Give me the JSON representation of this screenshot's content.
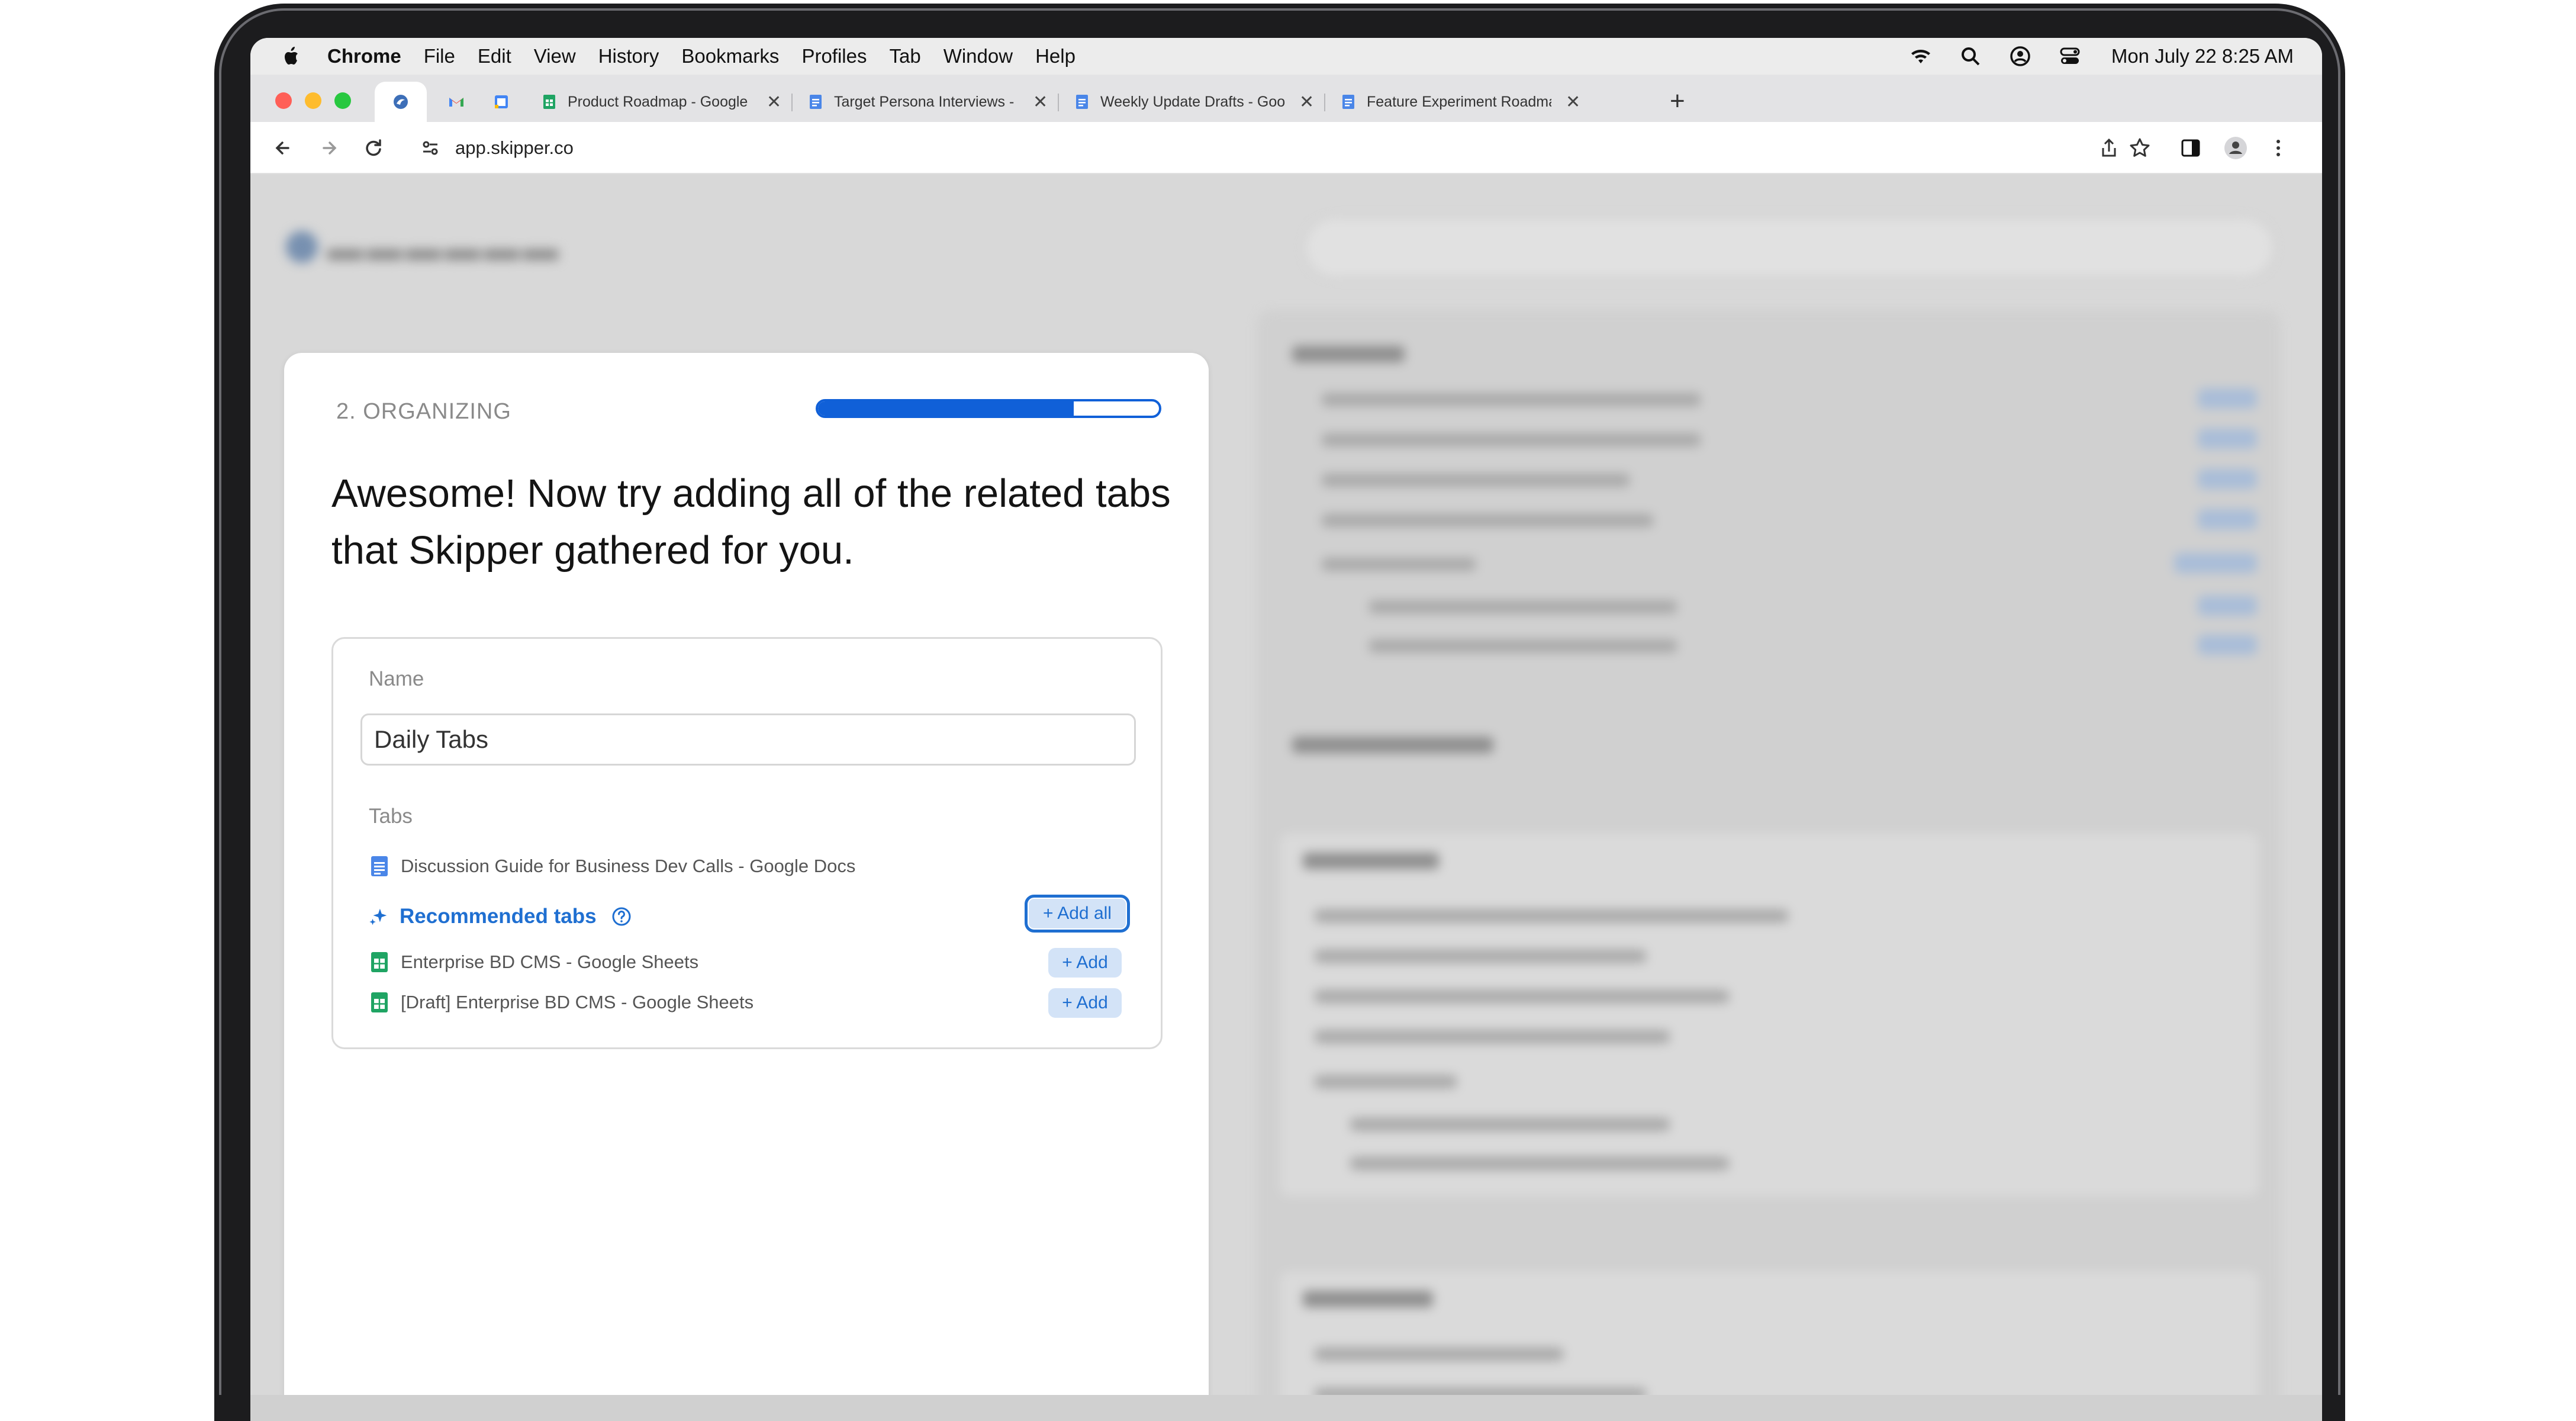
{
  "menubar": {
    "items": [
      "Chrome",
      "File",
      "Edit",
      "View",
      "History",
      "Bookmarks",
      "Profiles",
      "Tab",
      "Window",
      "Help"
    ],
    "clock": "Mon July 22  8:25 AM"
  },
  "browser": {
    "tabs": [
      {
        "title": "Product Roadmap - Google Sheets",
        "icon": "sheets-icon"
      },
      {
        "title": "Target Persona Interviews - Google Docs",
        "icon": "docs-icon"
      },
      {
        "title": "Weekly Update Drafts - Google Docs",
        "icon": "docs-icon"
      },
      {
        "title": "Feature Experiment Roadmap",
        "icon": "docs-icon"
      }
    ],
    "pinned": [
      "skipper-icon",
      "gmail-icon",
      "calendar-icon"
    ],
    "url": "app.skipper.co"
  },
  "onboarding": {
    "step": "2. ORGANIZING",
    "progress": 0.75,
    "heading": "Awesome! Now try adding all of the related tabs that Skipper gathered for you.",
    "name_label": "Name",
    "name_value": "Daily Tabs",
    "tabs_label": "Tabs",
    "tabs": [
      {
        "title": "Discussion Guide for Business Dev Calls - Google Docs",
        "icon": "docs-icon"
      }
    ],
    "recommended_label": "Recommended tabs",
    "add_all_label": "+ Add all",
    "recommended": [
      {
        "title": "Enterprise BD CMS - Google Sheets",
        "icon": "sheets-icon",
        "add_label": "+ Add"
      },
      {
        "title": "[Draft] Enterprise BD CMS - Google Sheets",
        "icon": "sheets-icon",
        "add_label": "+ Add"
      }
    ]
  },
  "colors": {
    "accent": "#1f6fd1",
    "progress": "#1060d8",
    "docs_blue": "#4a86e8",
    "sheets_green": "#1fa463"
  }
}
